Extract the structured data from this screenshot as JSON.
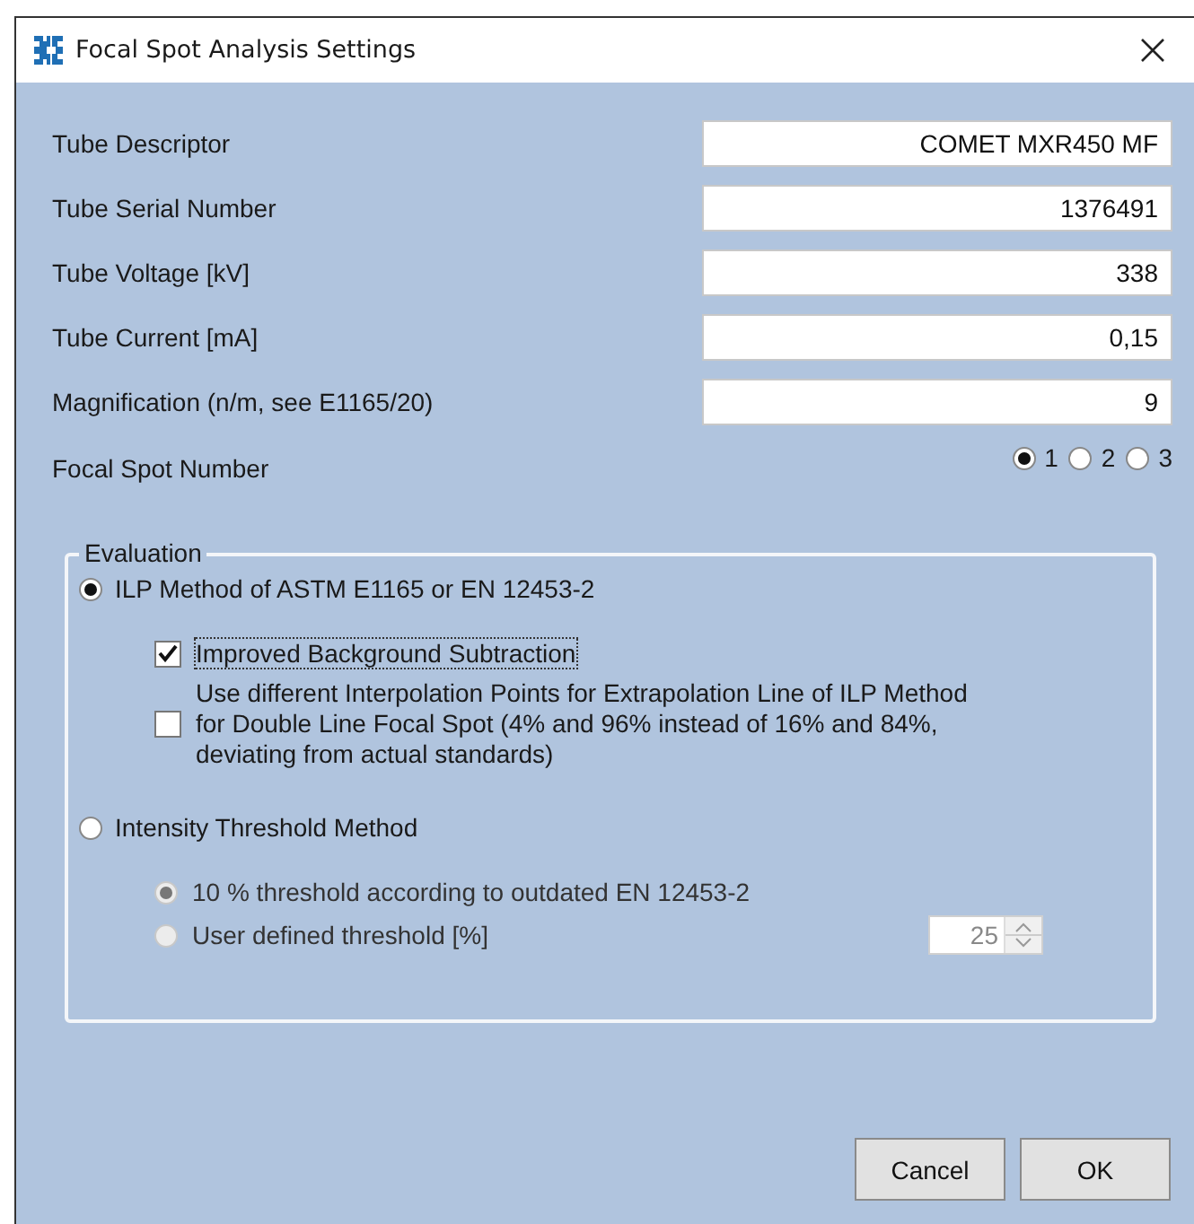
{
  "window": {
    "title": "Focal Spot Analysis Settings"
  },
  "fields": [
    {
      "label": "Tube Descriptor",
      "value": "COMET MXR450 MF"
    },
    {
      "label": "Tube Serial Number",
      "value": "1376491"
    },
    {
      "label": "Tube Voltage [kV]",
      "value": "338"
    },
    {
      "label": "Tube Current [mA]",
      "value": "0,15"
    },
    {
      "label": "Magnification (n/m, see E1165/20)",
      "value": "9"
    }
  ],
  "focal_spot": {
    "label": "Focal Spot Number",
    "options": [
      {
        "label": "1",
        "selected": true
      },
      {
        "label": "2",
        "selected": false
      },
      {
        "label": "3",
        "selected": false
      }
    ]
  },
  "evaluation": {
    "title": "Evaluation",
    "ilp": {
      "label": "ILP Method of ASTM E1165 or EN 12453-2",
      "selected": true,
      "options": [
        {
          "label": "Improved Background Subtraction",
          "checked": true,
          "focused": true
        },
        {
          "label": "Use different Interpolation Points for Extrapolation Line of ILP Method for Double Line Focal Spot (4% and 96% instead of 16% and 84%, deviating from actual standards)",
          "checked": false,
          "focused": false
        }
      ]
    },
    "threshold": {
      "label": "Intensity Threshold Method",
      "selected": false,
      "options": [
        {
          "label": "10 % threshold according to outdated EN 12453-2",
          "selected": true,
          "disabled": true
        },
        {
          "label": "User defined threshold [%]",
          "selected": false,
          "disabled": true
        }
      ],
      "spinner": {
        "value": "25",
        "disabled": true
      }
    }
  },
  "buttons": [
    "Cancel",
    "OK"
  ]
}
